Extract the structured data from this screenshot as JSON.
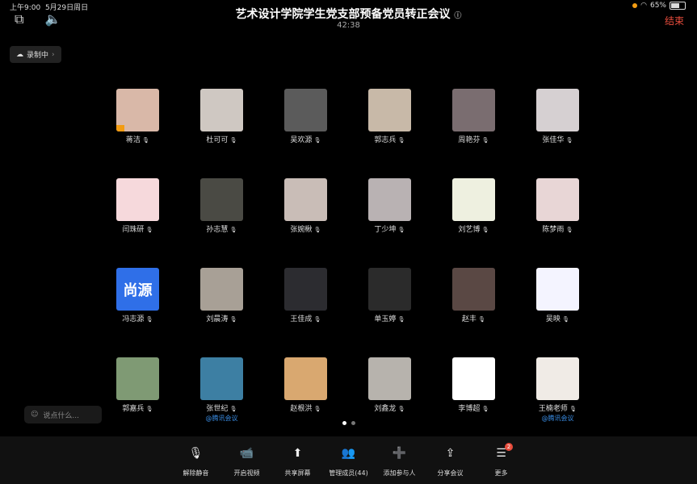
{
  "status_bar": {
    "time": "上午9:00",
    "date": "5月29日周日",
    "battery": "65%"
  },
  "meeting": {
    "title": "艺术设计学院学生党支部预备党员转正会议",
    "timer": "42:38",
    "end_label": "结束",
    "recording_label": "录制中"
  },
  "participants": [
    {
      "name": "蒋洁",
      "bg": "#d9b8a8",
      "speaking": true
    },
    {
      "name": "杜可可",
      "bg": "#cfc8c2"
    },
    {
      "name": "吴欢源",
      "bg": "#5b5b5b"
    },
    {
      "name": "郭志兵",
      "bg": "#c8b9a8"
    },
    {
      "name": "周艳芬",
      "bg": "#7a6d70"
    },
    {
      "name": "张佳华",
      "bg": "#d6d0d2"
    },
    {
      "name": "闫珠研",
      "bg": "#f6d9dc"
    },
    {
      "name": "孙志慧",
      "bg": "#4a4a44"
    },
    {
      "name": "张婉楸",
      "bg": "#c9bdb7"
    },
    {
      "name": "丁少坤",
      "bg": "#b9b2b3"
    },
    {
      "name": "刘艺博",
      "bg": "#eef0e0"
    },
    {
      "name": "陈梦雨",
      "bg": "#e8d6d6"
    },
    {
      "name": "冯志源",
      "bg": "#2f6fe8",
      "text": "尚源"
    },
    {
      "name": "刘晨涛",
      "bg": "#a8a096"
    },
    {
      "name": "王佳成",
      "bg": "#2c2c30"
    },
    {
      "name": "单玉婷",
      "bg": "#2b2b2b"
    },
    {
      "name": "赵丰",
      "bg": "#5a4844"
    },
    {
      "name": "吴映",
      "bg": "#f4f4ff"
    },
    {
      "name": "郭嘉兵",
      "bg": "#7f9a74"
    },
    {
      "name": "张世纪",
      "bg": "#3d7fa3",
      "tag": "@腾讯会议"
    },
    {
      "name": "赵根洪",
      "bg": "#d9a870"
    },
    {
      "name": "刘鑫龙",
      "bg": "#b7b3ad"
    },
    {
      "name": "李博超",
      "bg": "#ffffff"
    },
    {
      "name": "王楠老师",
      "bg": "#f0ebe6",
      "tag": "@腾讯会议"
    }
  ],
  "chat_placeholder": "说点什么...",
  "toolbar": [
    {
      "label": "解除静音",
      "icon": "mic-off-icon",
      "glyph": "🎙"
    },
    {
      "label": "开启视频",
      "icon": "video-off-icon",
      "glyph": "📹"
    },
    {
      "label": "共享屏幕",
      "icon": "share-screen-icon",
      "glyph": "⬆"
    },
    {
      "label": "管理成员(44)",
      "icon": "members-icon",
      "glyph": "👥"
    },
    {
      "label": "添加参与人",
      "icon": "add-user-icon",
      "glyph": "➕"
    },
    {
      "label": "分享会议",
      "icon": "share-icon",
      "glyph": "⇪"
    },
    {
      "label": "更多",
      "icon": "more-icon",
      "glyph": "☰",
      "badge": "2"
    }
  ]
}
